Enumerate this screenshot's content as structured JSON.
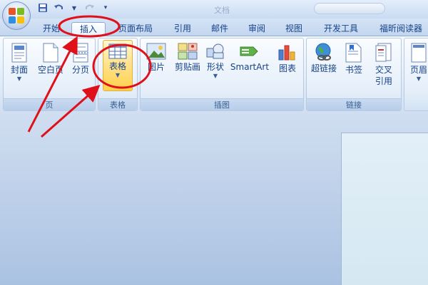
{
  "titlebar": {
    "qat": [
      "save-icon",
      "undo-icon",
      "redo-icon",
      "dropdown-icon"
    ],
    "doc_title": "文档"
  },
  "tabs": [
    {
      "label": "开始"
    },
    {
      "label": "插入",
      "active": true
    },
    {
      "label": "页面布局"
    },
    {
      "label": "引用"
    },
    {
      "label": "邮件"
    },
    {
      "label": "审阅"
    },
    {
      "label": "视图"
    },
    {
      "label": "开发工具"
    },
    {
      "label": "福昕阅读器"
    }
  ],
  "groups": {
    "pages": {
      "label": "页",
      "buttons": [
        "封面",
        "空白页",
        "分页"
      ]
    },
    "tables": {
      "label": "表格",
      "buttons": [
        "表格"
      ]
    },
    "illustrations": {
      "label": "插图",
      "buttons": [
        "图片",
        "剪贴画",
        "形状",
        "SmartArt",
        "图表"
      ]
    },
    "links": {
      "label": "链接",
      "buttons": [
        "超链接",
        "书签",
        "交叉",
        "引用"
      ]
    },
    "header": {
      "buttons": [
        "页眉"
      ]
    }
  },
  "colors": {
    "annotation": "#e0101a",
    "highlight": "#ffd04a"
  }
}
